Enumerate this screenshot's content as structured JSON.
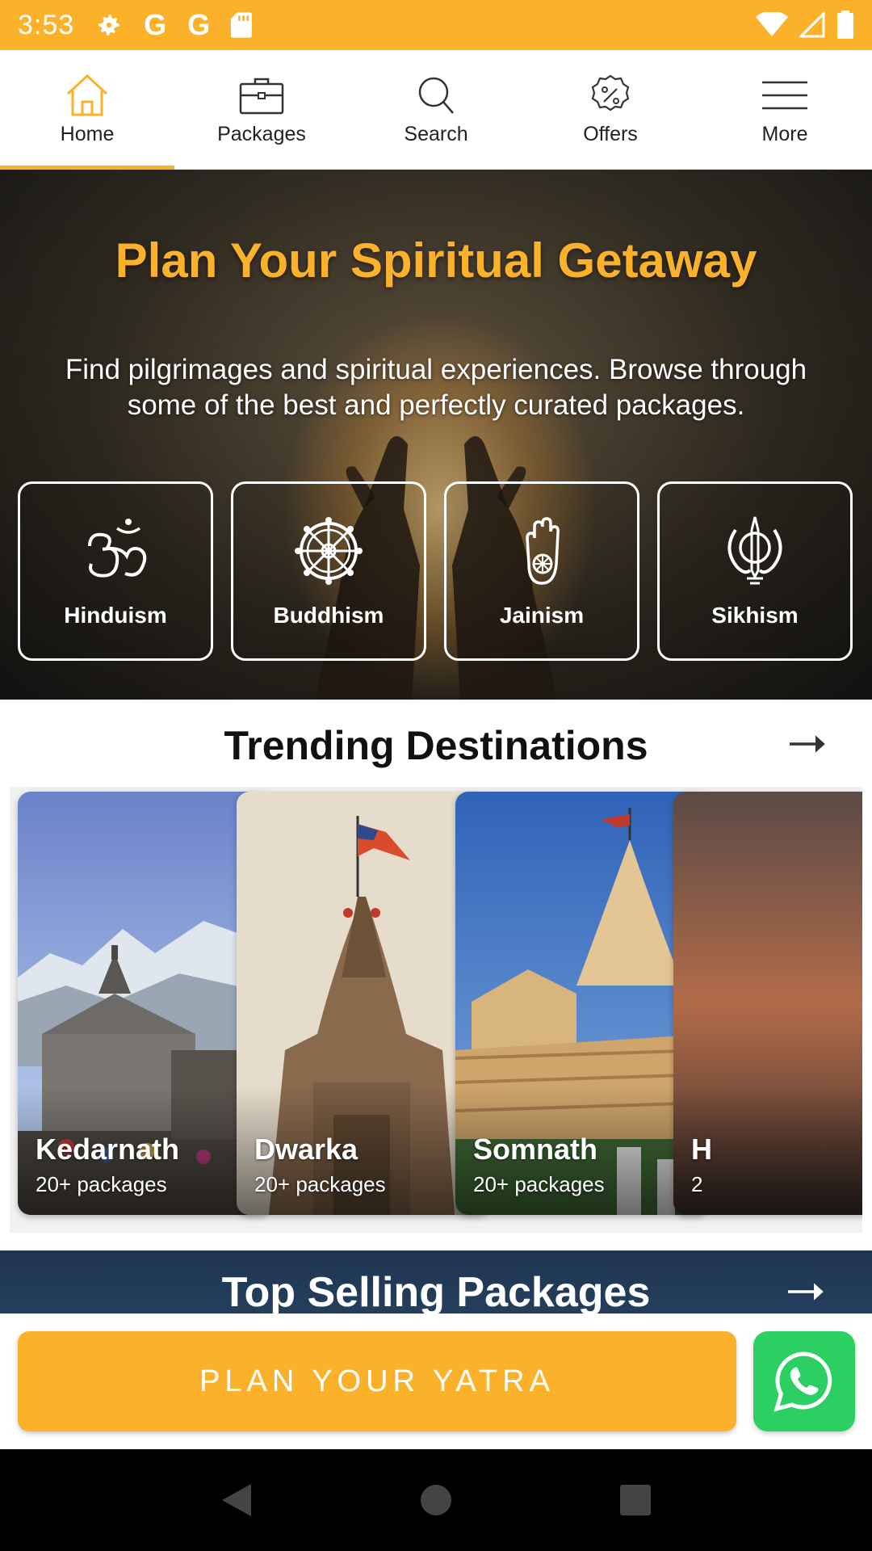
{
  "status_bar": {
    "time": "3:53",
    "icons": [
      "gear-icon",
      "google-icon",
      "google-icon",
      "sd-card-icon",
      "wifi-icon",
      "signal-icon",
      "battery-icon"
    ],
    "glyph_g": "G"
  },
  "nav": {
    "items": [
      {
        "label": "Home",
        "icon": "home-icon",
        "active": true
      },
      {
        "label": "Packages",
        "icon": "briefcase-icon",
        "active": false
      },
      {
        "label": "Search",
        "icon": "search-icon",
        "active": false
      },
      {
        "label": "Offers",
        "icon": "discount-badge-icon",
        "active": false
      },
      {
        "label": "More",
        "icon": "menu-icon",
        "active": false
      }
    ]
  },
  "hero": {
    "title": "Plan Your Spiritual Getaway",
    "subtitle": "Find pilgrimages and spiritual experiences. Browse through some of the best and perfectly curated packages.",
    "religions": [
      {
        "label": "Hinduism",
        "icon": "om-icon"
      },
      {
        "label": "Buddhism",
        "icon": "dharma-wheel-icon"
      },
      {
        "label": "Jainism",
        "icon": "jain-hand-icon"
      },
      {
        "label": "Sikhism",
        "icon": "khanda-icon"
      }
    ]
  },
  "trending": {
    "title": "Trending Destinations",
    "destinations": [
      {
        "name": "Kedarnath",
        "count": "20+ packages"
      },
      {
        "name": "Dwarka",
        "count": "20+ packages"
      },
      {
        "name": "Somnath",
        "count": "20+ packages"
      },
      {
        "name": "H",
        "count": "2"
      }
    ]
  },
  "top_selling": {
    "title": "Top Selling Packages"
  },
  "cta": {
    "plan_label": "PLAN YOUR YATRA",
    "whatsapp_icon": "whatsapp-icon"
  },
  "colors": {
    "accent": "#fbb12a",
    "whatsapp": "#2bcf62",
    "navy": "#1e3550"
  }
}
